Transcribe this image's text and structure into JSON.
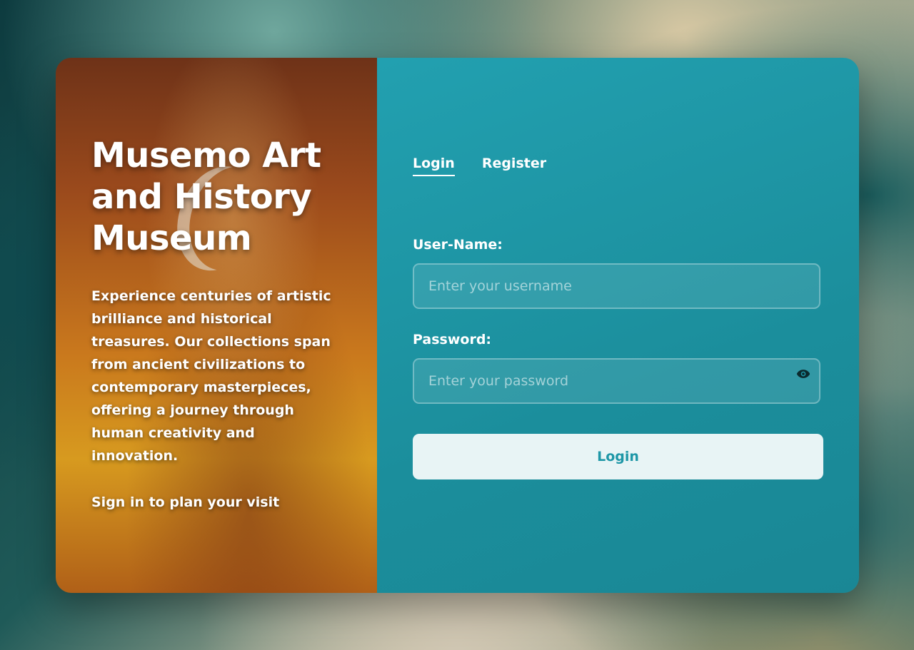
{
  "museum": {
    "title": "Musemo Art and History Museum",
    "description": "Experience centuries of artistic brilliance and historical treasures. Our collections span from ancient civilizations to contemporary masterpieces, offering a journey through human creativity and innovation.",
    "visit_prompt": "Sign in to plan your visit"
  },
  "tabs": [
    {
      "label": "Login",
      "active": true
    },
    {
      "label": "Register",
      "active": false
    }
  ],
  "form": {
    "username": {
      "label": "User-Name:",
      "placeholder": "Enter your username",
      "value": ""
    },
    "password": {
      "label": "Password:",
      "placeholder": "Enter your password",
      "value": "",
      "toggle_icon": "eye-icon"
    },
    "submit_label": "Login"
  },
  "colors": {
    "panel_teal": "#1e97a7",
    "button_bg": "#e8f4f5",
    "button_text": "#1e97a7",
    "left_panel_orange": "#c9781d"
  }
}
